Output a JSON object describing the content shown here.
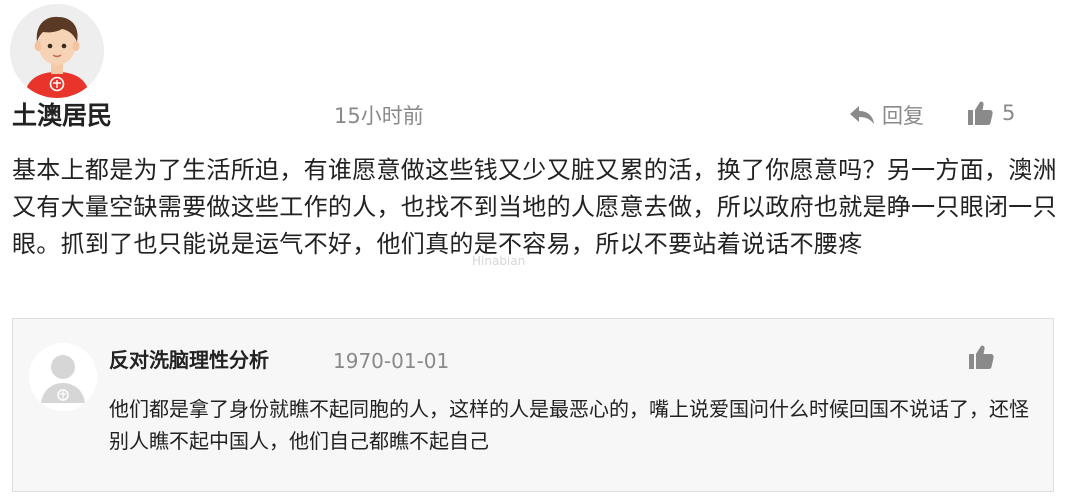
{
  "main_comment": {
    "username": "土澳居民",
    "time": "15小时前",
    "reply_label": "回复",
    "like_count": "5",
    "content": "基本上都是为了生活所迫，有谁愿意做这些钱又少又脏又累的活，换了你愿意吗？另一方面，澳洲又有大量空缺需要做这些工作的人，也找不到当地的人愿意去做，所以政府也就是睁一只眼闭一只眼。抓到了也只能说是运气不好，他们真的是不容易，所以不要站着说话不腰疼",
    "avatar_icon": "cartoon-user-avatar",
    "shirt_color": "#e8342b"
  },
  "watermark": "Hinabian",
  "nested_reply": {
    "username": "反对洗脑理性分析",
    "date": "1970-01-01",
    "content": "他们都是拿了身份就瞧不起同胞的人，这样的人是最恶心的，嘴上说爱国问什么时候回国不说话了，还怪别人瞧不起中国人，他们自己都瞧不起自己",
    "avatar_icon": "default-grey-avatar",
    "like_icon": "thumbs-up-icon"
  },
  "colors": {
    "text_primary": "#222222",
    "text_secondary": "#8a8a8a",
    "reply_box_bg": "#f7f7f7",
    "reply_box_border": "#dedede"
  }
}
